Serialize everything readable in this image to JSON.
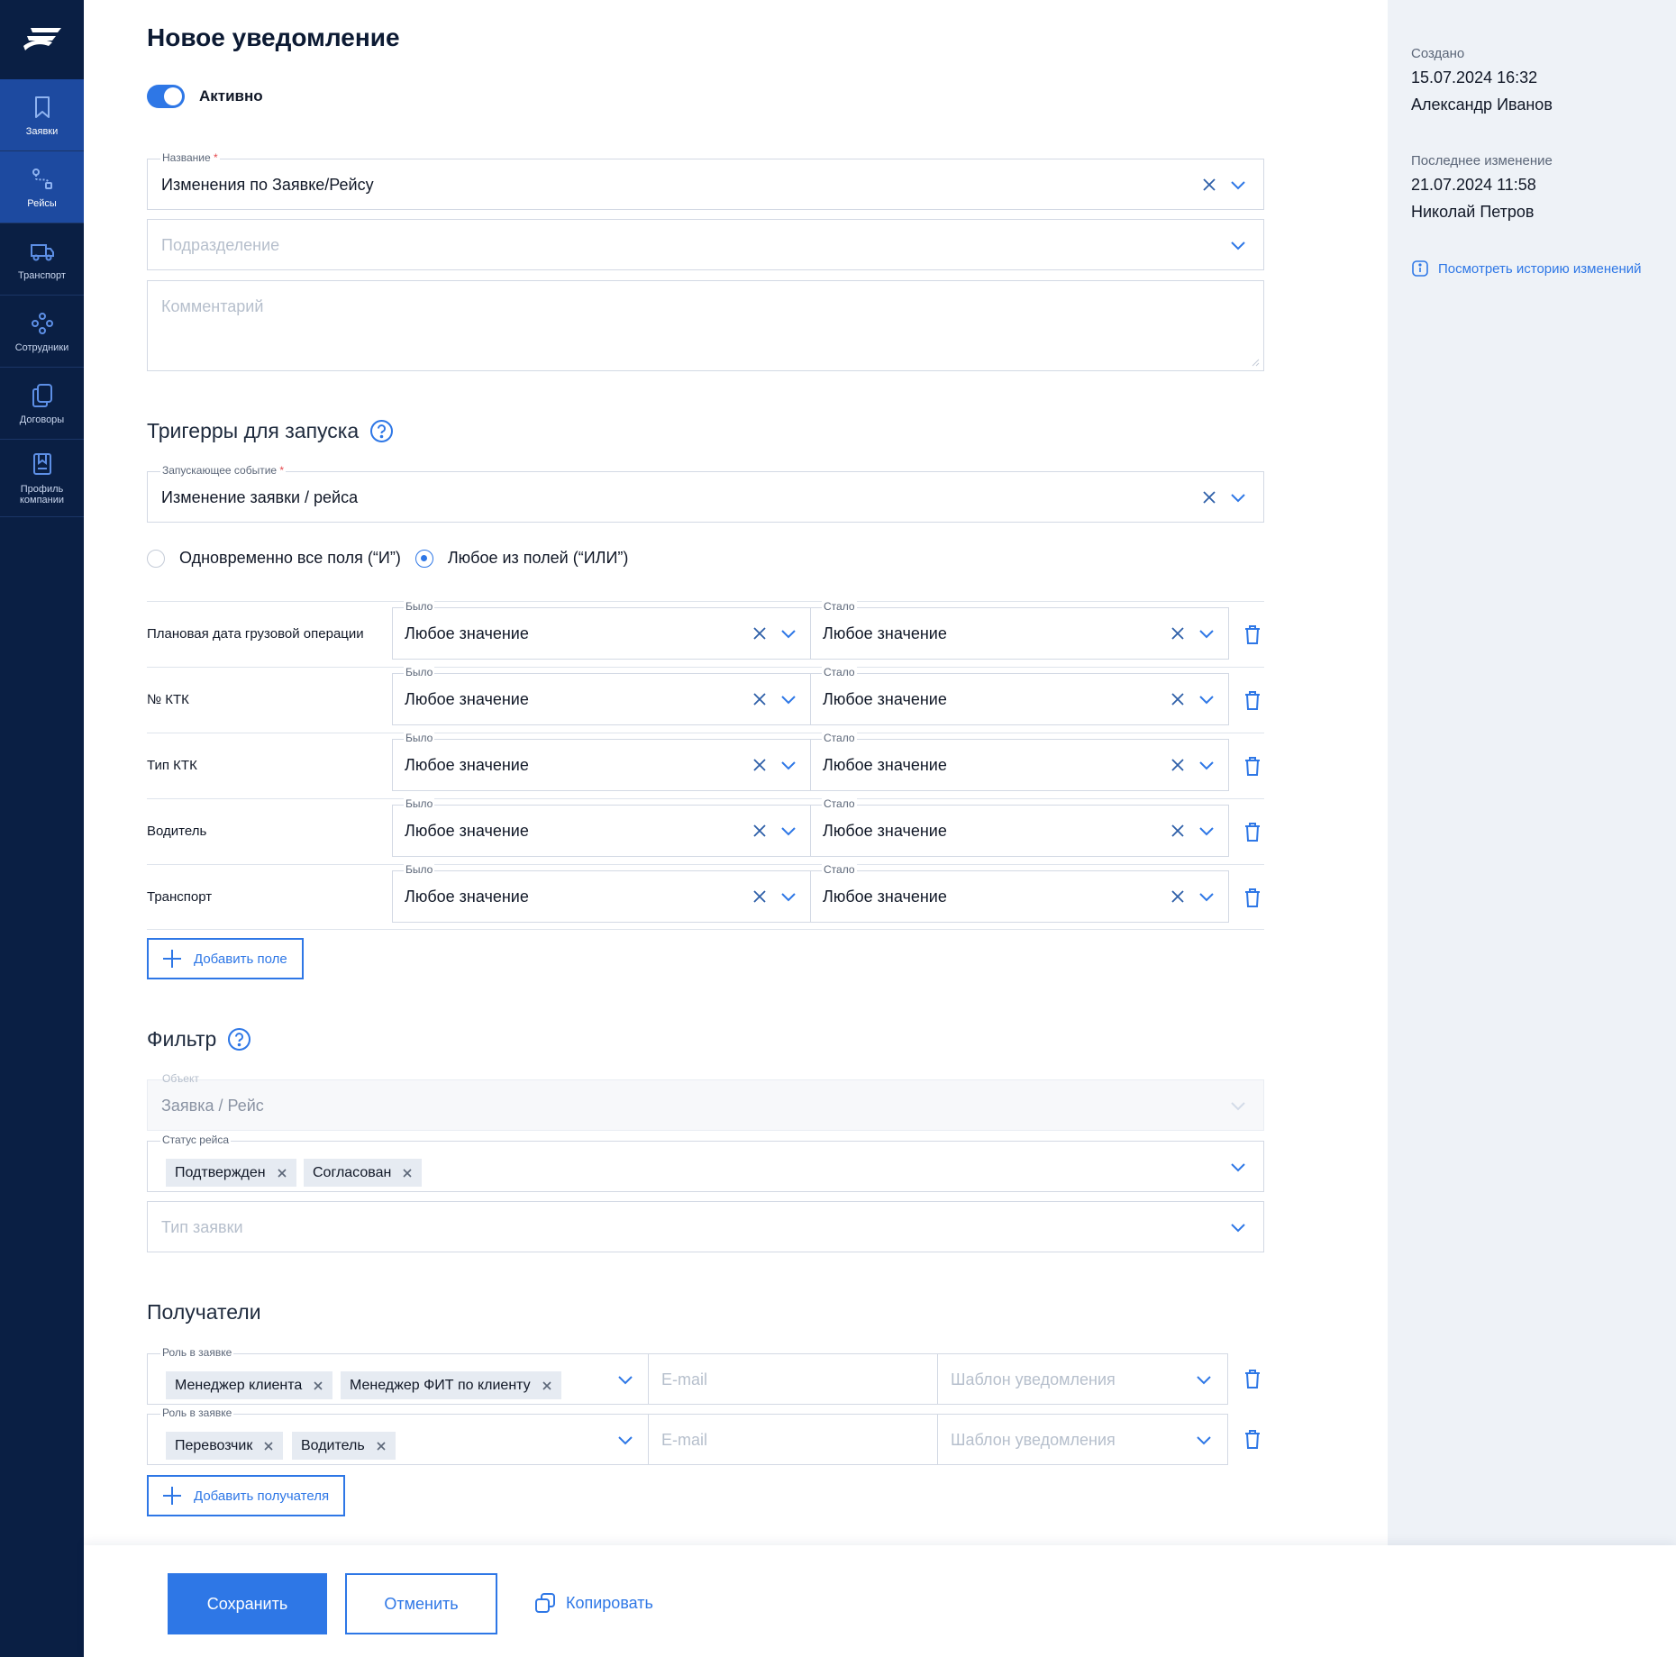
{
  "colors": {
    "accent": "#2e77e6",
    "sidebar": "#0a1f44",
    "sidebar_active": "#1d4aa0",
    "panel": "#eef2f7"
  },
  "sidebar": {
    "items": [
      {
        "label": "Заявки",
        "icon": "bookmark-icon"
      },
      {
        "label": "Рейсы",
        "icon": "route-icon"
      },
      {
        "label": "Транспорт",
        "icon": "truck-icon"
      },
      {
        "label": "Сотрудники",
        "icon": "people-icon"
      },
      {
        "label": "Договоры",
        "icon": "documents-icon"
      },
      {
        "label": "Профиль компании",
        "icon": "company-profile-icon"
      }
    ]
  },
  "page": {
    "title": "Новое уведомление"
  },
  "status": {
    "active_label": "Активно",
    "active": true
  },
  "form": {
    "name": {
      "label": "Название",
      "required_mark": "*",
      "value": "Изменения по Заявке/Рейсу"
    },
    "division": {
      "placeholder": "Подразделение"
    },
    "comment": {
      "placeholder": "Комментарий"
    }
  },
  "triggers": {
    "title": "Тригерры для запуска",
    "event": {
      "label": "Запускающее событие",
      "required_mark": "*",
      "value": "Изменение заявки / рейса"
    },
    "mode_all_label": "Одновременно все поля (“И”)",
    "mode_any_label": "Любое из полей (“ИЛИ”)",
    "selected_mode": "any",
    "was_label": "Было",
    "became_label": "Стало",
    "rows": [
      {
        "name": "Плановая дата грузовой операции",
        "was": "Любое значение",
        "became": "Любое значение"
      },
      {
        "name": "№ КТК",
        "was": "Любое значение",
        "became": "Любое значение"
      },
      {
        "name": "Тип КТК",
        "was": "Любое значение",
        "became": "Любое значение"
      },
      {
        "name": "Водитель",
        "was": "Любое значение",
        "became": "Любое значение"
      },
      {
        "name": "Транспорт",
        "was": "Любое значение",
        "became": "Любое значение"
      }
    ],
    "add_field_label": "Добавить поле"
  },
  "filter": {
    "title": "Фильтр",
    "object": {
      "label": "Объект",
      "value": "Заявка / Рейс"
    },
    "trip_status": {
      "label": "Статус рейса",
      "chips": [
        "Подтвержден",
        "Согласован"
      ]
    },
    "request_type": {
      "placeholder": "Тип заявки"
    }
  },
  "recipients": {
    "title": "Получатели",
    "role_label": "Роль в заявке",
    "email_placeholder": "E-mail",
    "template_placeholder": "Шаблон уведомления",
    "rows": [
      {
        "roles": [
          "Менеджер клиента",
          "Менеджер ФИТ по клиенту"
        ]
      },
      {
        "roles": [
          "Перевозчик",
          "Водитель"
        ]
      }
    ],
    "add_label": "Добавить получателя"
  },
  "info": {
    "created_label": "Создано",
    "created_date": "15.07.2024 16:32",
    "created_by": "Александр Иванов",
    "modified_label": "Последнее изменение",
    "modified_date": "21.07.2024 11:58",
    "modified_by": "Николай Петров",
    "history_link": "Посмотреть историю изменений"
  },
  "footer": {
    "save": "Сохранить",
    "cancel": "Отменить",
    "copy": "Копировать"
  }
}
